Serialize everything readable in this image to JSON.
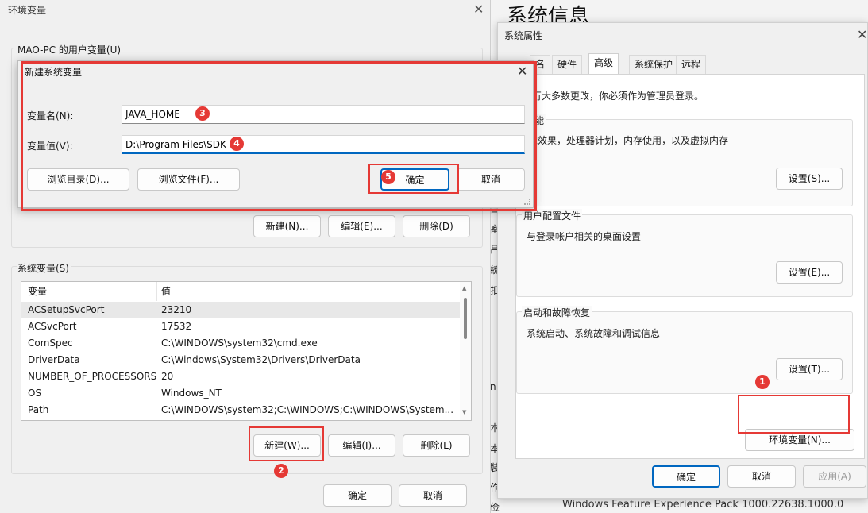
{
  "system_info": {
    "title": "系统信息",
    "feature_pack": "Windows Feature Experience Pack 1000.22638.1000.0",
    "strip_chars": [
      "目",
      "畜",
      "吕",
      "統",
      "扣",
      "n",
      "本",
      "本",
      "裝",
      "作",
      "俭"
    ]
  },
  "system_properties": {
    "title": "系统属性",
    "tabs": [
      "计算机名",
      "硬件",
      "高级",
      "系统保护",
      "远程"
    ],
    "tab_visible_partial": "名",
    "admin_note": "要进行大多数更改，你必须作为管理员登录。",
    "admin_note_visible": "进行大多数更改，你必须作为管理员登录。",
    "performance": {
      "title": "性能",
      "title_visible": "能",
      "desc": "视觉效果，处理器计划，内存使用，以及虚拟内存",
      "desc_visible": "觉效果，处理器计划，内存使用，以及虚拟内存",
      "button": "设置(S)..."
    },
    "user_profiles": {
      "title": "用户配置文件",
      "desc": "与登录帐户相关的桌面设置",
      "button": "设置(E)..."
    },
    "startup_recovery": {
      "title": "启动和故障恢复",
      "desc": "系统启动、系统故障和调试信息",
      "button": "设置(T)..."
    },
    "env_button": "环境变量(N)...",
    "ok": "确定",
    "cancel": "取消",
    "apply": "应用(A)"
  },
  "env_vars": {
    "title": "环境变量",
    "user_section": "MAO-PC 的用户变量(U)",
    "user_buttons": {
      "new": "新建(N)...",
      "edit": "编辑(E)...",
      "delete": "删除(D)"
    },
    "system_section": "系统变量(S)",
    "columns": {
      "name": "变量",
      "value": "值"
    },
    "rows": [
      {
        "name": "ACSetupSvcPort",
        "value": "23210"
      },
      {
        "name": "ACSvcPort",
        "value": "17532"
      },
      {
        "name": "ComSpec",
        "value": "C:\\WINDOWS\\system32\\cmd.exe"
      },
      {
        "name": "DriverData",
        "value": "C:\\Windows\\System32\\Drivers\\DriverData"
      },
      {
        "name": "NUMBER_OF_PROCESSORS",
        "value": "20"
      },
      {
        "name": "OS",
        "value": "Windows_NT"
      },
      {
        "name": "Path",
        "value": "C:\\WINDOWS\\system32;C:\\WINDOWS;C:\\WINDOWS\\System..."
      }
    ],
    "system_buttons": {
      "new": "新建(W)...",
      "edit": "编辑(I)...",
      "delete": "删除(L)"
    },
    "ok": "确定",
    "cancel": "取消"
  },
  "new_var_dialog": {
    "title": "新建系统变量",
    "name_label": "变量名(N):",
    "name_value": "JAVA_HOME",
    "value_label": "变量值(V):",
    "value_value": "D:\\Program Files\\SDK",
    "browse_dir": "浏览目录(D)...",
    "browse_file": "浏览文件(F)...",
    "ok": "确定",
    "cancel": "取消"
  },
  "steps": [
    "1",
    "2",
    "3",
    "4",
    "5"
  ],
  "colors": {
    "highlight": "#e53935",
    "accent": "#0067c0"
  }
}
